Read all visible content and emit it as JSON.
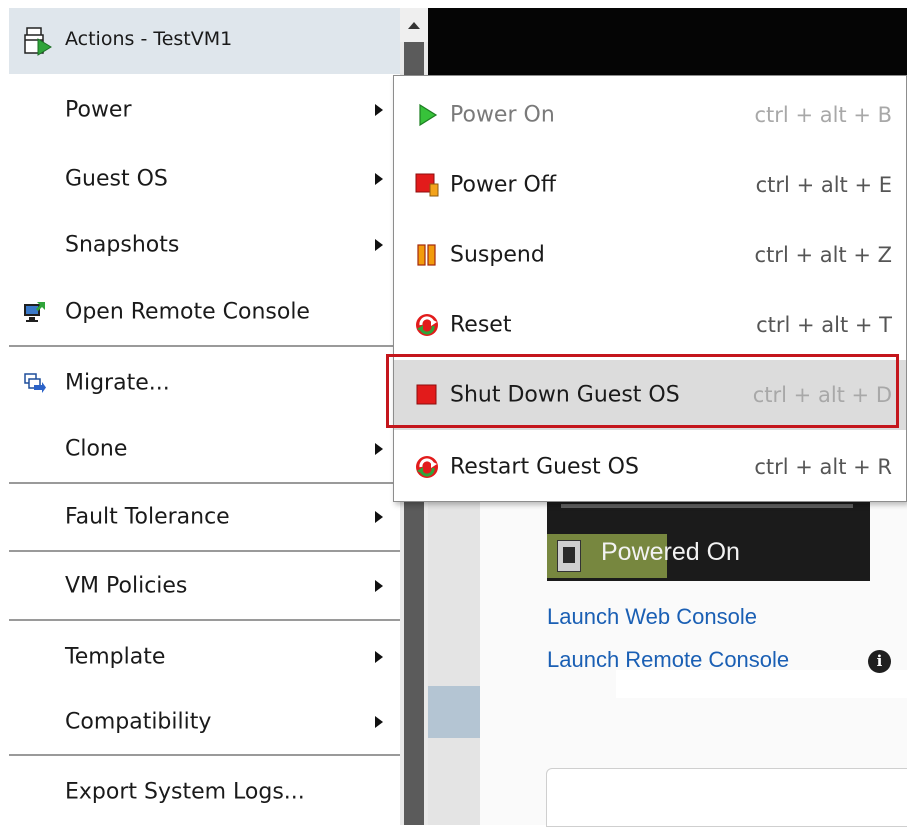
{
  "header": {
    "title": "Actions - TestVM1",
    "icon": "vm-actions-icon"
  },
  "menu": {
    "items": [
      {
        "label": "Power",
        "submenu": true
      },
      {
        "label": "Guest OS",
        "submenu": true
      },
      {
        "label": "Snapshots",
        "submenu": true
      },
      {
        "label": "Open Remote Console",
        "icon": "remote-console-icon"
      },
      {
        "label": "Migrate...",
        "icon": "migrate-icon"
      },
      {
        "label": "Clone",
        "submenu": true
      },
      {
        "label": "Fault Tolerance",
        "submenu": true
      },
      {
        "label": "VM Policies",
        "submenu": true
      },
      {
        "label": "Template",
        "submenu": true
      },
      {
        "label": "Compatibility",
        "submenu": true
      },
      {
        "label": "Export System Logs..."
      }
    ]
  },
  "power_submenu": {
    "items": [
      {
        "label": "Power On",
        "shortcut": "ctrl + alt + B",
        "icon": "play-icon",
        "enabled": false
      },
      {
        "label": "Power Off",
        "shortcut": "ctrl + alt + E",
        "icon": "power-off-icon",
        "enabled": true
      },
      {
        "label": "Suspend",
        "shortcut": "ctrl + alt + Z",
        "icon": "pause-icon",
        "enabled": true
      },
      {
        "label": "Reset",
        "shortcut": "ctrl + alt + T",
        "icon": "reset-icon",
        "enabled": true
      },
      {
        "label": "Shut Down Guest OS",
        "shortcut": "ctrl + alt + D",
        "icon": "stop-icon",
        "enabled": false,
        "highlighted": true
      },
      {
        "label": "Restart Guest OS",
        "shortcut": "ctrl + alt + R",
        "icon": "restart-icon",
        "enabled": true
      }
    ]
  },
  "vm_summary": {
    "state": "Powered On",
    "links": [
      "Launch Web Console",
      "Launch Remote Console"
    ]
  },
  "colors": {
    "header_bg": "#dfe6ec",
    "highlight_outline": "#c4161c",
    "link": "#1a5fb4",
    "play_green": "#2fb52f",
    "power_red": "#e21b1b",
    "pause_orange": "#f29b0c"
  }
}
